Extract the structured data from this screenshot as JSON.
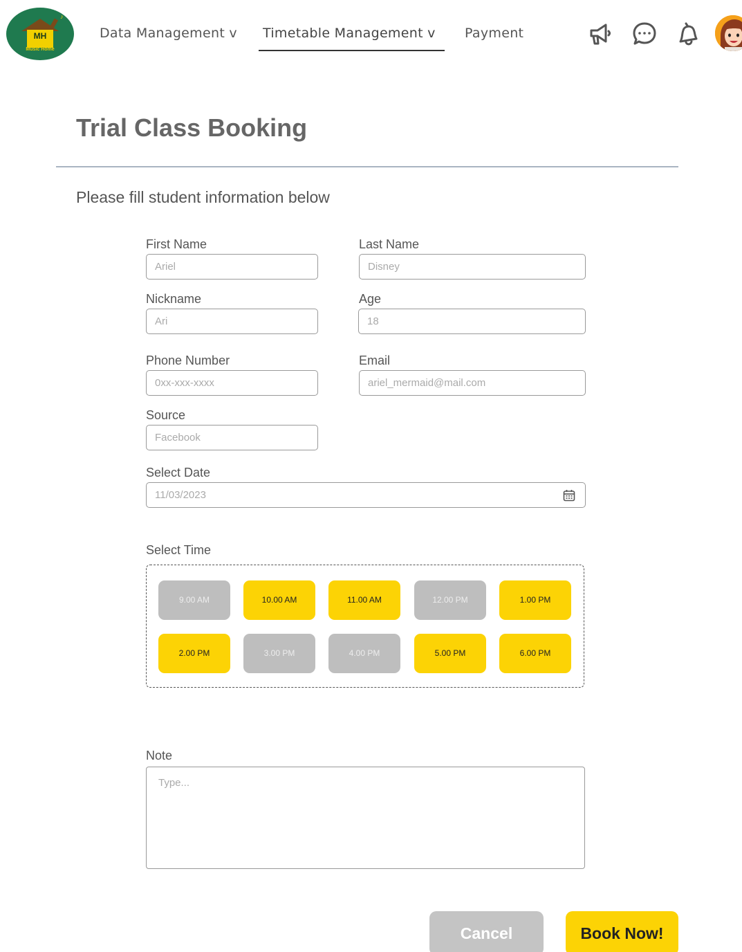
{
  "nav": {
    "logo_text": "MH",
    "logo_sub": "Music Home",
    "items": [
      {
        "label": "Data Management v"
      },
      {
        "label": "Timetable Management v"
      },
      {
        "label": "Payment"
      }
    ],
    "icons": [
      "megaphone-icon",
      "chat-icon",
      "bell-icon",
      "avatar"
    ]
  },
  "page": {
    "title": "Trial Class Booking",
    "subtitle": "Please fill student information below"
  },
  "form": {
    "first_name": {
      "label": "First Name",
      "placeholder": "Ariel"
    },
    "last_name": {
      "label": "Last Name",
      "placeholder": "Disney"
    },
    "nickname": {
      "label": "Nickname",
      "placeholder": "Ari"
    },
    "age": {
      "label": "Age",
      "placeholder": "18"
    },
    "phone": {
      "label": "Phone Number",
      "placeholder": "0xx-xxx-xxxx"
    },
    "email": {
      "label": "Email",
      "placeholder": "ariel_mermaid@mail.com"
    },
    "source": {
      "label": "Source",
      "placeholder": "Facebook"
    },
    "date": {
      "label": "Select Date",
      "placeholder": "11/03/2023"
    },
    "time": {
      "label": "Select Time",
      "slots": [
        {
          "label": "9.00 AM",
          "available": false
        },
        {
          "label": "10.00 AM",
          "available": true
        },
        {
          "label": "11.00 AM",
          "available": true
        },
        {
          "label": "12.00 PM",
          "available": false
        },
        {
          "label": "1.00 PM",
          "available": true
        },
        {
          "label": "2.00 PM",
          "available": true
        },
        {
          "label": "3.00 PM",
          "available": false
        },
        {
          "label": "4.00 PM",
          "available": false
        },
        {
          "label": "5.00 PM",
          "available": true
        },
        {
          "label": "6.00 PM",
          "available": true
        }
      ]
    },
    "note": {
      "label": "Note",
      "placeholder": "Type..."
    }
  },
  "actions": {
    "cancel": "Cancel",
    "book": "Book Now!"
  },
  "colors": {
    "accent": "#fcd305",
    "disabled": "#bebebe",
    "brand": "#1f7a4f",
    "divider": "#a9b4c2"
  }
}
